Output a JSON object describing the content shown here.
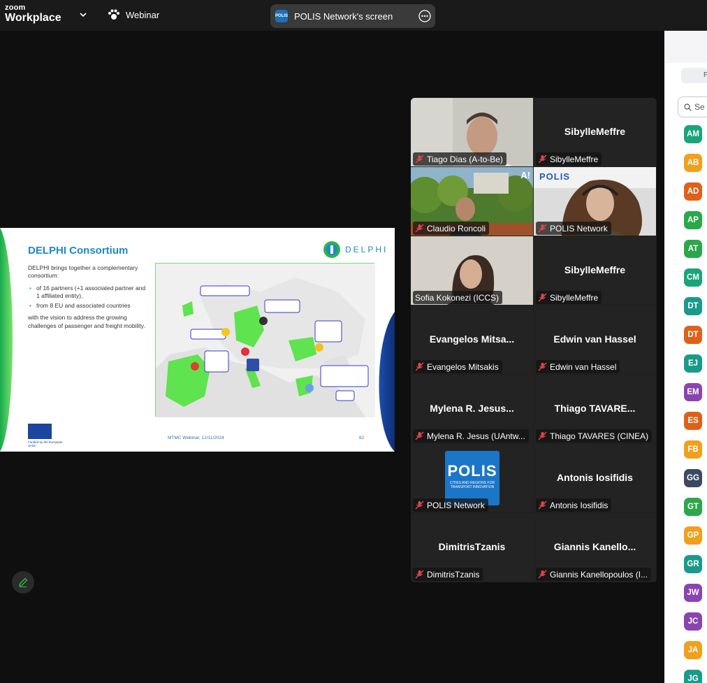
{
  "topbar": {
    "brand_top": "zoom",
    "brand_bottom": "Workplace",
    "webinar_label": "Webinar",
    "share_logo": "POLIS",
    "share_title": "POLIS Network's screen"
  },
  "slide": {
    "title": "DELPHI Consortium",
    "logo_text": "DELPHI",
    "intro": "DELPHI brings together a complementary consortium:",
    "bullets": [
      "of 16 partners (+1 associated partner and 1 affiliated entity),",
      "from 8 EU and associated countries"
    ],
    "vision": "with the vision to address the growing challenges of passenger and freight mobility.",
    "footer_center": "MTMC Webinar, 12/11/2024",
    "page_number": "62",
    "eu_caption": "Funded by the European Union"
  },
  "tiles": [
    {
      "name": "Tiago Dias (A-to-Be)",
      "display": "",
      "video": true
    },
    {
      "name": "SibylleMeffre",
      "display": "SibylleMeffre",
      "video": false
    },
    {
      "name": "Claudio Roncoli",
      "display": "",
      "video": true
    },
    {
      "name": "POLIS Network",
      "display": "",
      "video": true,
      "banner": "POLIS"
    },
    {
      "name": "Sofia Kokonezi (ICCS)",
      "display": "",
      "video": true
    },
    {
      "name": "SibylleMeffre",
      "display": "SibylleMeffre",
      "video": false
    },
    {
      "name": "Evangelos Mitsakis",
      "display": "Evangelos  Mitsa...",
      "video": false
    },
    {
      "name": "Edwin van Hassel",
      "display": "Edwin van Hassel",
      "video": false
    },
    {
      "name": "Mylena R. Jesus (UAntw...",
      "display": "Mylena R. Jesus...",
      "video": false
    },
    {
      "name": "Thiago TAVARES (CINEA)",
      "display": "Thiago  TAVARE...",
      "video": false
    },
    {
      "name": "POLIS Network",
      "display": "",
      "video": false,
      "logo": "POLIS",
      "logo_sub": "CITIES AND REGIONS FOR TRANSPORT INNOVATION"
    },
    {
      "name": "Antonis Iosifidis",
      "display": "Antonis Iosifidis",
      "video": false
    },
    {
      "name": "DimitrisTzanis",
      "display": "DimitrisTzanis",
      "video": false
    },
    {
      "name": "Giannis Kanellopoulos (I...",
      "display": "Giannis  Kanello...",
      "video": false
    }
  ],
  "panel": {
    "button_partial": "P",
    "search_placeholder": "Se",
    "avatars": [
      {
        "initials": "AM",
        "color": "#1aa47a"
      },
      {
        "initials": "AB",
        "color": "#f0a01c"
      },
      {
        "initials": "AD",
        "color": "#e0601a"
      },
      {
        "initials": "AP",
        "color": "#2aa84a"
      },
      {
        "initials": "AT",
        "color": "#2aa84a"
      },
      {
        "initials": "CM",
        "color": "#1aa47a"
      },
      {
        "initials": "DT",
        "color": "#1a9a8a"
      },
      {
        "initials": "DT",
        "color": "#e0601a"
      },
      {
        "initials": "EJ",
        "color": "#1a9a8a"
      },
      {
        "initials": "EM",
        "color": "#8a44b0"
      },
      {
        "initials": "ES",
        "color": "#e0601a"
      },
      {
        "initials": "FB",
        "color": "#f0a01c"
      },
      {
        "initials": "GG",
        "color": "#3a4a60"
      },
      {
        "initials": "GT",
        "color": "#2aa84a"
      },
      {
        "initials": "GP",
        "color": "#f0a01c"
      },
      {
        "initials": "GR",
        "color": "#1a9a8a"
      },
      {
        "initials": "JW",
        "color": "#8a44b0"
      },
      {
        "initials": "JC",
        "color": "#8a44b0"
      },
      {
        "initials": "JA",
        "color": "#f0a01c"
      },
      {
        "initials": "JG",
        "color": "#1a9a8a"
      }
    ]
  },
  "colors": {
    "muted_red": "#e0454a",
    "active_green": "#2db34a"
  }
}
